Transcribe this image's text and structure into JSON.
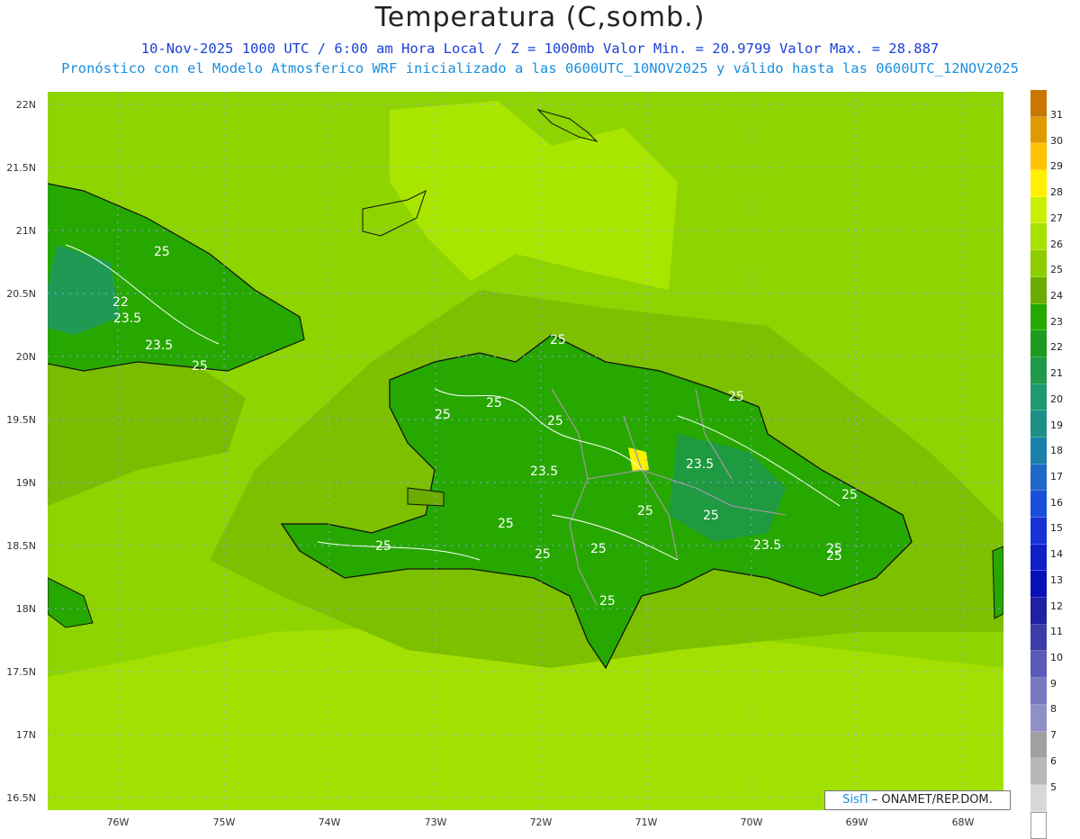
{
  "header": {
    "title": "Temperatura (C,somb.)",
    "line1": "10-Nov-2025  1000 UTC / 6:00 am Hora Local / Z = 1000mb    Valor Min. = 20.9799  Valor Max. = 28.887",
    "line2": "Pronóstico con el Modelo Atmosferico WRF inicializado a las 0600UTC_10NOV2025 y válido hasta las  0600UTC_12NOV2025"
  },
  "axes": {
    "lat_labels": [
      "22N",
      "21.5N",
      "21N",
      "20.5N",
      "20N",
      "19.5N",
      "19N",
      "18.5N",
      "18N",
      "17.5N",
      "17N",
      "16.5N"
    ],
    "lon_labels": [
      "76W",
      "75W",
      "74W",
      "73W",
      "72W",
      "71W",
      "70W",
      "69W",
      "68W"
    ]
  },
  "contour_labels": [
    "25",
    "22",
    "23.5",
    "23.5",
    "25",
    "25",
    "25",
    "25",
    "25",
    "25",
    "23.5",
    "25",
    "25",
    "25",
    "25",
    "25",
    "25",
    "23.5",
    "25",
    "25",
    "25",
    "23.5",
    "25"
  ],
  "colorbar": {
    "labels": [
      "31",
      "30",
      "29",
      "28",
      "27",
      "26",
      "25",
      "24",
      "23",
      "22",
      "21",
      "20",
      "19",
      "18",
      "17",
      "16",
      "15",
      "14",
      "13",
      "12",
      "11",
      "10",
      "9",
      "8",
      "7",
      "6",
      "5"
    ],
    "colors": [
      "#c87800",
      "#e09a00",
      "#ffc400",
      "#fff000",
      "#c9f000",
      "#a8e000",
      "#8ccd00",
      "#6aac00",
      "#27a800",
      "#1e9a20",
      "#209a4a",
      "#1f9a6e",
      "#1e8f88",
      "#1b80a8",
      "#2068c8",
      "#1a50d8",
      "#1434d8",
      "#1020c8",
      "#0a10b8",
      "#2020a0",
      "#3c3ca8",
      "#5a5ab8",
      "#7878c0",
      "#9090c8",
      "#a0a0a0",
      "#b8b8b8",
      "#d8d8d8",
      "#ffffff"
    ]
  },
  "credit": {
    "brand": "SisΠ",
    "text": "– ONAMET/REP.DOM."
  }
}
